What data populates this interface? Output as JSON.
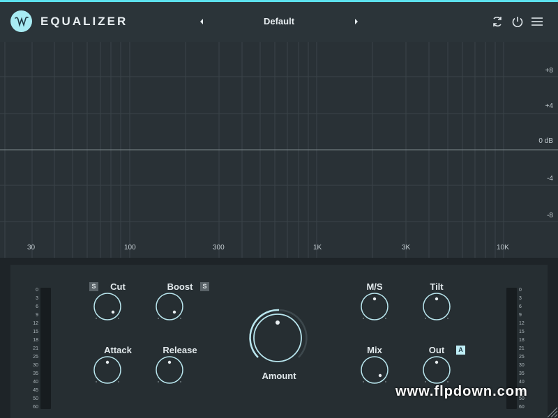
{
  "header": {
    "title": "EQUALIZER",
    "preset": "Default",
    "icons": [
      "w-logo-icon",
      "chevron-left-icon",
      "chevron-right-icon",
      "refresh-icon",
      "power-icon",
      "menu-icon"
    ]
  },
  "graph": {
    "db_labels": [
      "+8",
      "+4",
      "0 dB",
      "-4",
      "-8"
    ],
    "freq_labels": [
      "30",
      "100",
      "300",
      "1K",
      "3K",
      "10K"
    ]
  },
  "meters": {
    "scale": [
      "0",
      "3",
      "6",
      "9",
      "12",
      "15",
      "18",
      "21",
      "25",
      "30",
      "35",
      "40",
      "45",
      "50",
      "60"
    ]
  },
  "knobs": {
    "cut": {
      "label": "Cut",
      "badge": "S"
    },
    "boost": {
      "label": "Boost",
      "badge": "S"
    },
    "attack": {
      "label": "Attack"
    },
    "release": {
      "label": "Release"
    },
    "amount": {
      "label": "Amount"
    },
    "ms": {
      "label": "M/S"
    },
    "tilt": {
      "label": "Tilt"
    },
    "mix": {
      "label": "Mix"
    },
    "out": {
      "label": "Out",
      "badge": "A"
    }
  },
  "watermark": "www.flpdown.com",
  "colors": {
    "accent": "#5ce1ee",
    "header_bg": "#2b3439",
    "graph_bg": "#293136",
    "panel_bg": "#262e32",
    "knob_ring": "#b9e6ee"
  }
}
